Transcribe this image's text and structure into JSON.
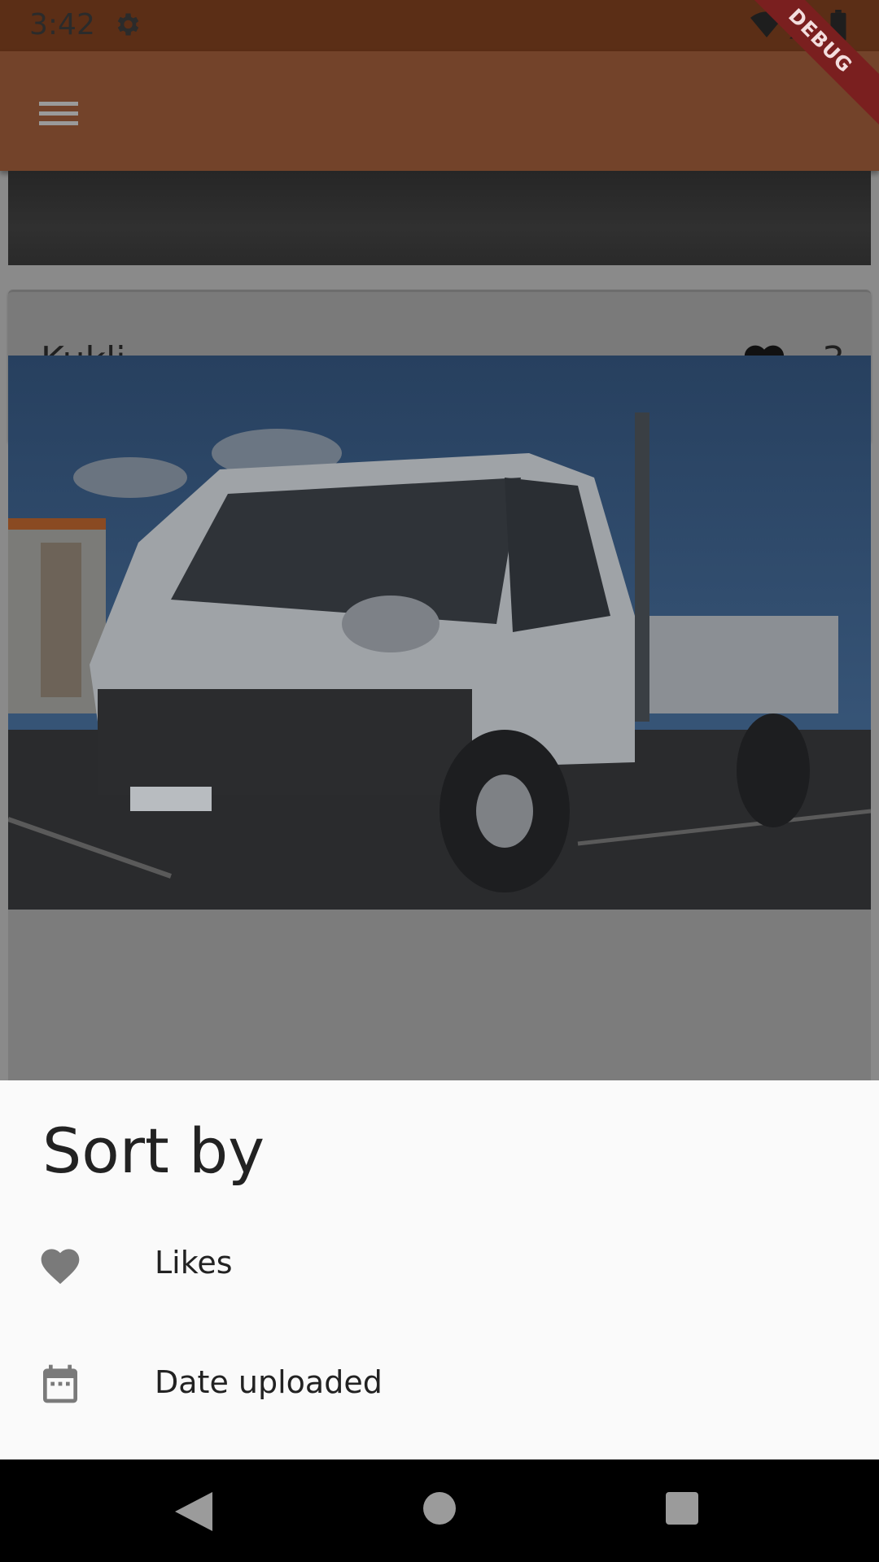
{
  "status_bar": {
    "time": "3:42",
    "icons": [
      "gear-icon",
      "wifi-icon",
      "signal-icon",
      "battery-icon"
    ]
  },
  "app_bar": {
    "menu_icon": "hamburger-menu-icon",
    "debug_banner": "DEBUG",
    "color": "#73432a"
  },
  "feed": {
    "posts": [
      {
        "title": "Kukli",
        "likes": "3"
      }
    ]
  },
  "sort_sheet": {
    "title": "Sort by",
    "options": [
      {
        "label": "Likes",
        "icon": "heart-icon"
      },
      {
        "label": "Date uploaded",
        "icon": "calendar-icon"
      }
    ]
  },
  "nav_bar": {
    "buttons": [
      "back-icon",
      "home-icon",
      "recents-icon"
    ]
  }
}
